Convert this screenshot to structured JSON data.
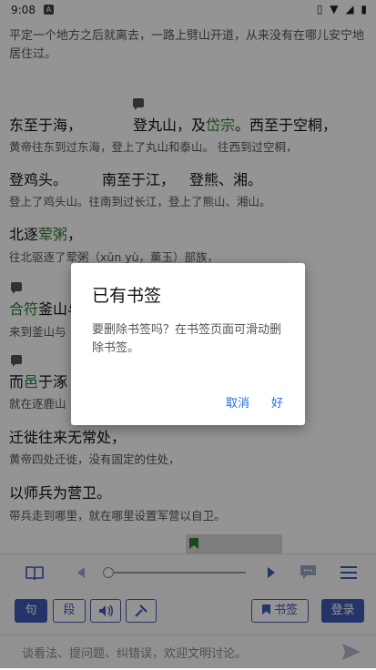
{
  "status": {
    "time": "9:08",
    "notif_icon": "A",
    "indicators": "▯ ▼ ◢ ▮"
  },
  "intro": "平定一个地方之后就离去，一路上劈山开道，从来没有在哪儿安宁地居住过。",
  "lines": [
    {
      "big": [
        "东至于海，",
        "登丸山，及",
        "岱宗",
        "。西至于空桐，"
      ],
      "small": "黄帝往东到过东海，登上了丸山和泰山。  往西到过空桐，"
    },
    {
      "big": [
        "登鸡头。",
        "南至于江，",
        "登熊、湘。"
      ],
      "small": "登上了鸡头山。往南到过长江，登上了熊山、湘山。"
    },
    {
      "big": [
        "北逐",
        "荤粥",
        "，"
      ],
      "small": "往北驱逐了荤粥（xūn yù，薰玉）部族，"
    },
    {
      "big": [
        "合符",
        "釜山与"
      ],
      "small": "来到釜山与"
    },
    {
      "big": [
        "而",
        "邑",
        "于涿"
      ],
      "small": "就在逐鹿山"
    },
    {
      "big": [
        "迁徙往来无常处，"
      ],
      "small": "黄帝四处迁徙，没有固定的住处，"
    },
    {
      "big": [
        "以师兵为营卫。"
      ],
      "small": "带兵走到哪里，就在哪里设置军营以自卫。"
    }
  ],
  "dialog": {
    "title": "已有书签",
    "message": "要删除书签吗？在书签页面可滑动删除书签。",
    "cancel": "取消",
    "ok": "好"
  },
  "toolbar": {
    "progress": 0.0
  },
  "actions": {
    "sentence": "句",
    "paragraph": "段",
    "bookmark": "书签",
    "login": "登录"
  },
  "comment": {
    "placeholder": "谈看法、提问题、纠错误，欢迎文明讨论。"
  },
  "colors": {
    "accent": "#3b5bb5",
    "highlight": "#2e7d32"
  }
}
